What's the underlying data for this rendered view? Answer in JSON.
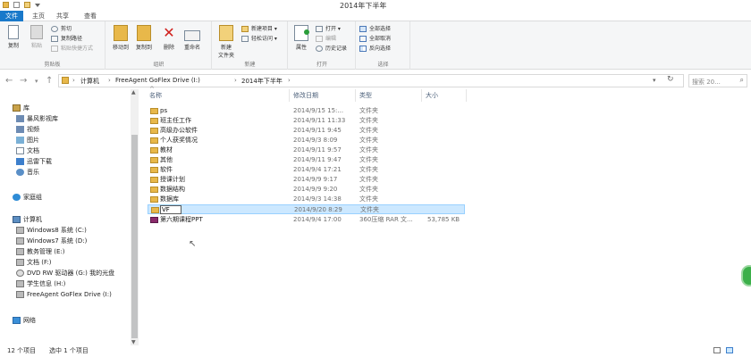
{
  "window": {
    "title": "2014年下半年"
  },
  "tabs": [
    "文件",
    "主页",
    "共享",
    "查看"
  ],
  "ribbon": {
    "clipboard": {
      "label": "剪贴板",
      "copy": "复制",
      "paste": "粘贴",
      "cut": "剪切",
      "copy_path": "复制路径",
      "paste_shortcut": "粘贴快捷方式"
    },
    "organize": {
      "label": "组织",
      "move_to": "移动到",
      "copy_to": "复制到",
      "delete": "删除",
      "rename": "重命名"
    },
    "new": {
      "label": "新建",
      "new_folder": "新建\n文件夹",
      "new_item": "新建项目",
      "easy_access": "轻松访问"
    },
    "open": {
      "label": "打开",
      "properties": "属性",
      "open": "打开",
      "edit": "编辑",
      "history": "历史记录"
    },
    "select": {
      "label": "选择",
      "select_all": "全部选择",
      "select_none": "全部取消",
      "invert": "反向选择"
    }
  },
  "address": {
    "crumbs": [
      "计算机",
      "FreeAgent GoFlex Drive (I:)",
      "2014年下半年"
    ],
    "search_placeholder": "搜索 20..."
  },
  "nav": {
    "library": "库",
    "library_items": [
      "暴风影视库",
      "视频",
      "图片",
      "文档",
      "迅雷下载",
      "音乐"
    ],
    "homegroup": "家庭组",
    "computer": "计算机",
    "computer_items": [
      "Windows8 系统 (C:)",
      "Windows7 系统 (D:)",
      "教务管理 (E:)",
      "文档 (F:)",
      "DVD RW 驱动器 (G:) 我的光盘",
      "学生信息 (H:)",
      "FreeAgent GoFlex Drive (I:)"
    ],
    "network": "网络"
  },
  "columns": {
    "name": "名称",
    "date": "修改日期",
    "type": "类型",
    "size": "大小"
  },
  "files": [
    {
      "name": "ps",
      "date": "2014/9/15 15:...",
      "type": "文件夹",
      "size": ""
    },
    {
      "name": "班主任工作",
      "date": "2014/9/11 11:33",
      "type": "文件夹",
      "size": ""
    },
    {
      "name": "高级办公软件",
      "date": "2014/9/11 9:45",
      "type": "文件夹",
      "size": ""
    },
    {
      "name": "个人获奖情况",
      "date": "2014/9/3 8:09",
      "type": "文件夹",
      "size": ""
    },
    {
      "name": "教材",
      "date": "2014/9/11 9:57",
      "type": "文件夹",
      "size": ""
    },
    {
      "name": "其他",
      "date": "2014/9/11 9:47",
      "type": "文件夹",
      "size": ""
    },
    {
      "name": "软件",
      "date": "2014/9/4 17:21",
      "type": "文件夹",
      "size": ""
    },
    {
      "name": "授课计划",
      "date": "2014/9/9 9:17",
      "type": "文件夹",
      "size": ""
    },
    {
      "name": "数据结构",
      "date": "2014/9/9 9:20",
      "type": "文件夹",
      "size": ""
    },
    {
      "name": "数据库",
      "date": "2014/9/3 14:38",
      "type": "文件夹",
      "size": ""
    },
    {
      "name": "VF",
      "date": "2014/9/20 8:29",
      "type": "文件夹",
      "size": ""
    },
    {
      "name": "第六期课程PPT",
      "date": "2014/9/4 17:00",
      "type": "360压缩 RAR 文...",
      "size": "53,785 KB"
    }
  ],
  "status": {
    "count": "12 个项目",
    "selected": "选中 1 个项目"
  },
  "colors": {
    "accent": "#1979ca",
    "folder": "#e8b84a",
    "selection": "#cce8ff"
  }
}
